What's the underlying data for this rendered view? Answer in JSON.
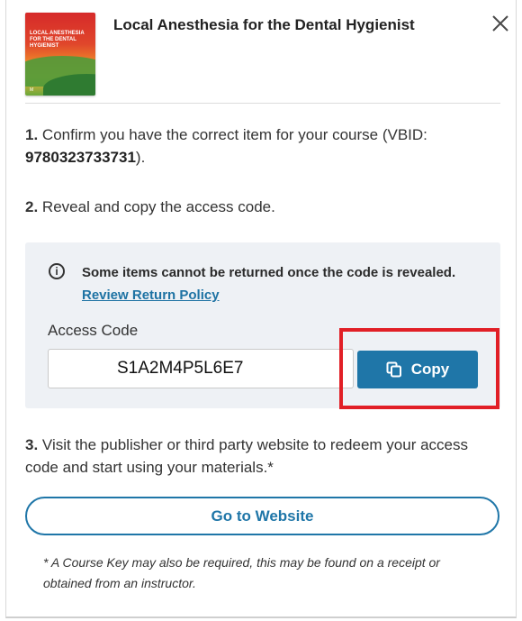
{
  "header": {
    "title": "Local Anesthesia for the Dental Hygienist",
    "close_icon": "close-icon",
    "cover": {
      "title_lines": "Local Anesthesia for the Dental Hygienist",
      "publisher_mark": "M"
    }
  },
  "steps": {
    "step1": {
      "number": "1.",
      "text_before": "Confirm you have the correct item for your course (VBID: ",
      "vbid": "9780323733731",
      "text_after": ")."
    },
    "step2": {
      "number": "2.",
      "text": "Reveal and copy the access code."
    },
    "step3": {
      "number": "3.",
      "text": "Visit the publisher or third party website to redeem your access code and start using your materials.*"
    }
  },
  "access_panel": {
    "info_icon": "info-icon",
    "notice_text": "Some items cannot be returned once the code is revealed.",
    "policy_link": "Review Return Policy",
    "code_label": "Access Code",
    "code_value": "S1A2M4P5L6E7",
    "copy_label": "Copy",
    "copy_icon": "copy-icon"
  },
  "actions": {
    "go_to_website": "Go to Website"
  },
  "footnote": "* A Course Key may also be required, this may be found on a receipt or obtained from an instructor.",
  "colors": {
    "accent": "#1f76a8",
    "highlight": "#e11f26",
    "panel_bg": "#eef1f5"
  }
}
